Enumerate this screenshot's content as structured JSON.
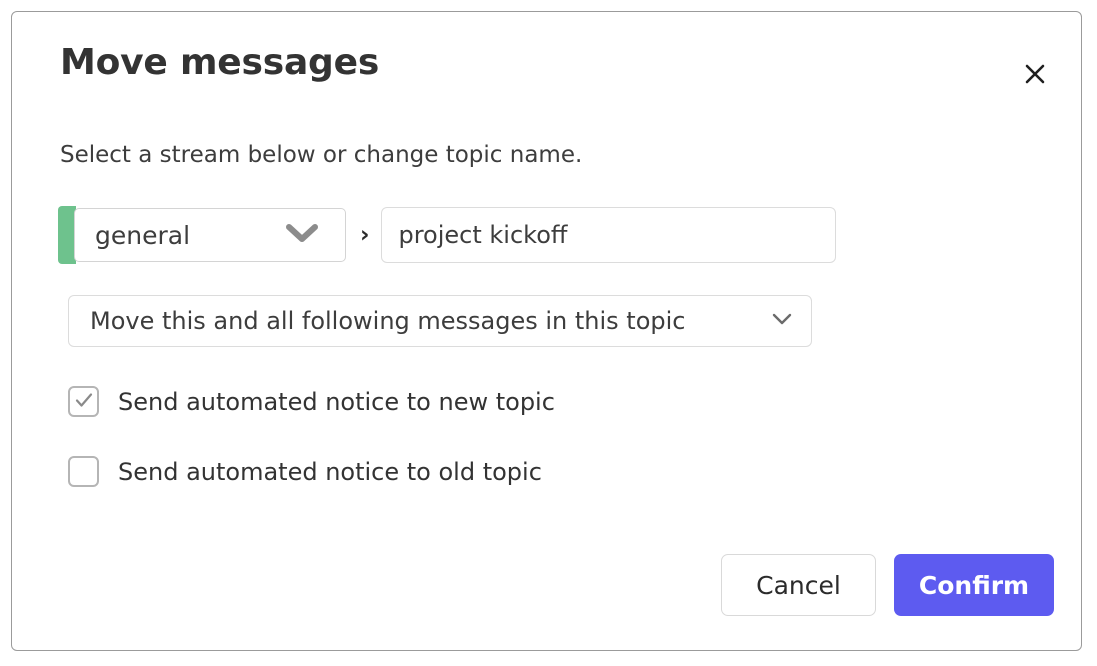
{
  "dialog": {
    "title": "Move messages",
    "subtitle": "Select a stream below or change topic name.",
    "close_icon": "close-icon"
  },
  "stream_selector": {
    "selected_stream": "general",
    "stream_color": "#6ec28d",
    "chevron_icon": "chevron-down-icon",
    "separator": "›"
  },
  "topic_field": {
    "value": "project kickoff",
    "placeholder": "Topic"
  },
  "propagate_selector": {
    "selected_option": "Move this and all following messages in this topic",
    "chevron_icon": "chevron-down-icon"
  },
  "checkboxes": [
    {
      "label": "Send automated notice to new topic",
      "checked": true,
      "check_icon": "check-icon"
    },
    {
      "label": "Send automated notice to old topic",
      "checked": false,
      "check_icon": "check-icon"
    }
  ],
  "footer": {
    "cancel_label": "Cancel",
    "confirm_label": "Confirm",
    "confirm_color": "#5d5bf0"
  }
}
